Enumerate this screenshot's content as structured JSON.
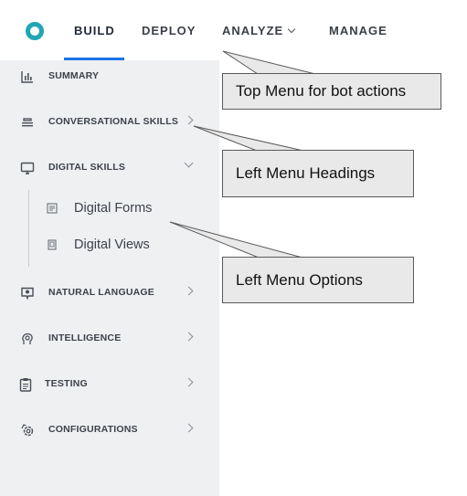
{
  "topnav": {
    "tabs": [
      {
        "label": "BUILD",
        "active": true
      },
      {
        "label": "DEPLOY"
      },
      {
        "label": "ANALYZE"
      },
      {
        "label": "MANAGE"
      }
    ],
    "active_color": "#1a73e8",
    "logo_color": "#22a6b3"
  },
  "sidebar": {
    "items": [
      {
        "label": "SUMMARY",
        "icon": "bar-chart-icon"
      },
      {
        "label": "CONVERSATIONAL SKILLS",
        "icon": "stack-icon"
      },
      {
        "label": "DIGITAL SKILLS",
        "icon": "monitor-icon",
        "expanded": true,
        "children": [
          {
            "label": "Digital Forms",
            "icon": "form-icon"
          },
          {
            "label": "Digital Views",
            "icon": "view-icon"
          }
        ]
      },
      {
        "label": "NATURAL LANGUAGE",
        "icon": "chat-icon"
      },
      {
        "label": "INTELLIGENCE",
        "icon": "brain-icon"
      },
      {
        "label": "TESTING",
        "icon": "clipboard-icon"
      },
      {
        "label": "CONFIGURATIONS",
        "icon": "settings-icon"
      }
    ]
  },
  "callouts": [
    {
      "text": "Top Menu for bot actions"
    },
    {
      "text": "Left Menu Headings"
    },
    {
      "text": "Left Menu Options"
    }
  ]
}
